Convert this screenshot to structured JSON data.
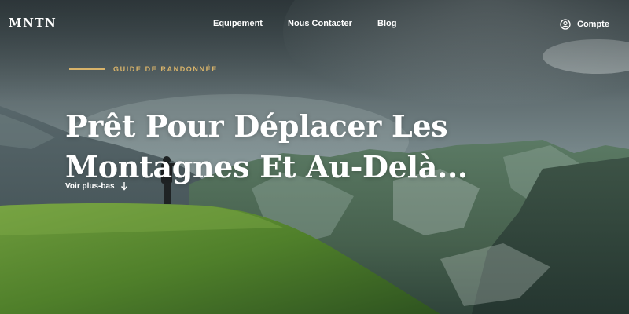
{
  "brand": {
    "logo_text": "MNTN"
  },
  "nav": {
    "items": [
      "Equipement",
      "Nous Contacter",
      "Blog"
    ],
    "account_label": "Compte"
  },
  "hero": {
    "eyebrow": "GUIDE DE RANDONNÉE",
    "headline_line1": "Prêt Pour Déplacer Les",
    "headline_line2": "Montagnes Et Au-Delà...",
    "scroll_label": "Voir plus-bas"
  },
  "icons": {
    "account": "user-circle-icon",
    "scroll": "arrow-down-icon"
  },
  "colors": {
    "accent": "#d8b36a",
    "text": "#ffffff",
    "sky": "#6f8083",
    "grass": "#5a8a2c"
  }
}
